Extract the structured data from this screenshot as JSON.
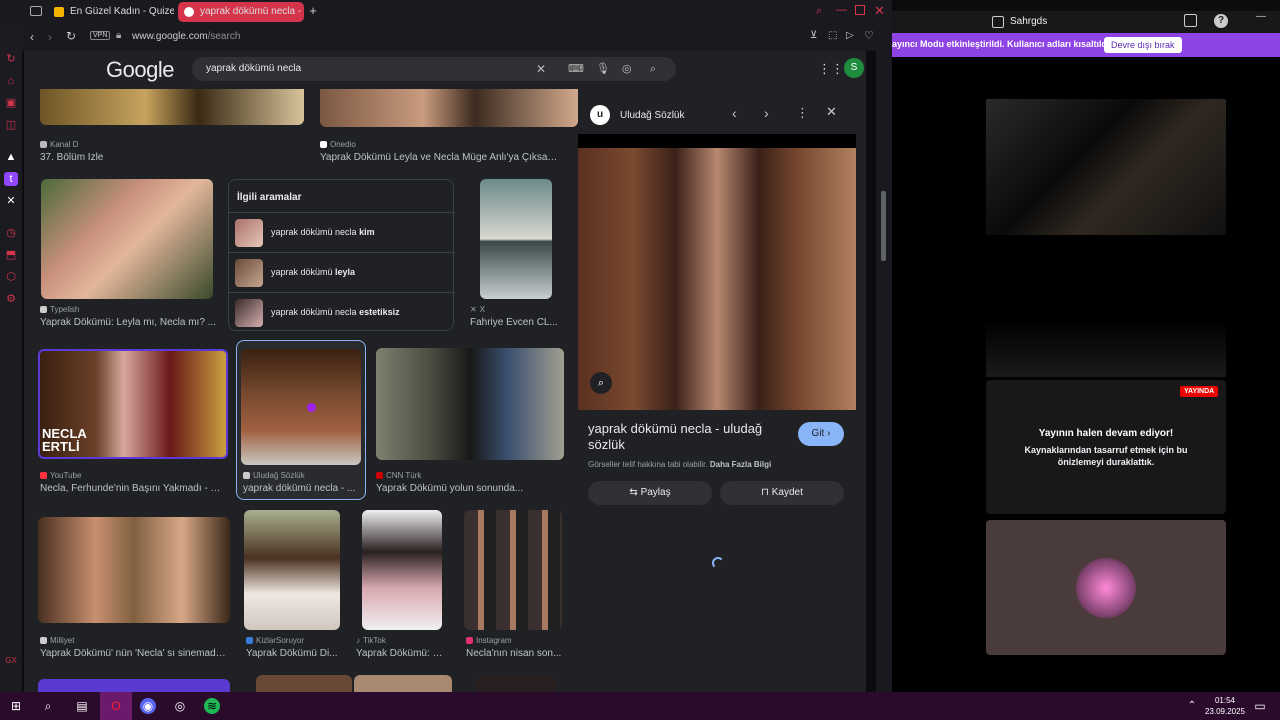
{
  "browser": {
    "tabs": [
      {
        "label": "En Güzel Kadın - Quizei"
      },
      {
        "label": "yaprak dökümü necla - G"
      }
    ],
    "vpn_label": "VPN",
    "url_domain": "www.google.com",
    "url_path": "/search"
  },
  "google": {
    "logo": "Google",
    "query": "yaprak dökümü necla",
    "account_initial": "S",
    "results": [
      {
        "source": "Kanal D",
        "title": "37. Bölüm İzle"
      },
      {
        "source": "Onedio",
        "title": "Yaprak Dökümü Leyla ve Necla Müge Anlı'ya Çıksa - ..."
      },
      {
        "source": "Typelish",
        "title": "Yaprak Dökümü: Leyla mı, Necla mı? ..."
      },
      {
        "source": "X",
        "title": "Fahriye Evcen CL..."
      },
      {
        "source": "YouTube",
        "title": "Necla, Ferhunde'nin Başını Yakmadı - Ya..."
      },
      {
        "source": "Uludağ Sözlük",
        "title": "yaprak dökümü necla - ..."
      },
      {
        "source": "CNN Türk",
        "title": "Yaprak Dökümü yolun sonunda..."
      },
      {
        "source": "Milliyet",
        "title": "Yaprak Dökümü' nün 'Necla' sı sinemada ..."
      },
      {
        "source": "KizlarSoruyor",
        "title": "Yaprak Dökümü Di..."
      },
      {
        "source": "TikTok",
        "title": "Yaprak Dökümü: N..."
      },
      {
        "source": "Instagram",
        "title": "Necla'nın nisan son..."
      }
    ],
    "overlay_text": {
      "line1": "NECLA",
      "line2": "ERTLİ"
    },
    "related": {
      "heading": "İlgili aramalar",
      "items": [
        {
          "prefix": "yaprak dökümü necla ",
          "bold": "kim"
        },
        {
          "prefix": "yaprak dökümü ",
          "bold": "leyla"
        },
        {
          "prefix": "yaprak dökümü necla ",
          "bold": "estetiksiz"
        }
      ]
    },
    "panel": {
      "site_name": "Uludağ Sözlük",
      "title_line1": "yaprak dökümü necla - uludağ",
      "title_line2": "sözlük",
      "visit_label": "Git",
      "copyright_prefix": "Görseller telif hakkına tabi olabilir. ",
      "copyright_link": "Daha Fazla Bilgi",
      "share_label": "Paylaş",
      "save_label": "Kaydet"
    }
  },
  "twitch": {
    "username": "Sahrgds",
    "banner_text": "ayıncı Modu etkinleştirildi. Kullanıcı adları kısaltıldı.",
    "banner_button": "Devre dışı bırak",
    "live_badge": "YAYINDA",
    "paused_title": "Yayının halen devam ediyor!",
    "paused_sub": "Kaynaklarından tasarruf etmek için bu önizlemeyi duraklattık."
  },
  "taskbar": {
    "time": "01:54",
    "date": "23.09.2025"
  },
  "colors": {
    "opera_red": "#d4354b",
    "google_bg": "#202124",
    "twitch_purple": "#8e44e4",
    "taskbar": "#2a0b2c"
  }
}
